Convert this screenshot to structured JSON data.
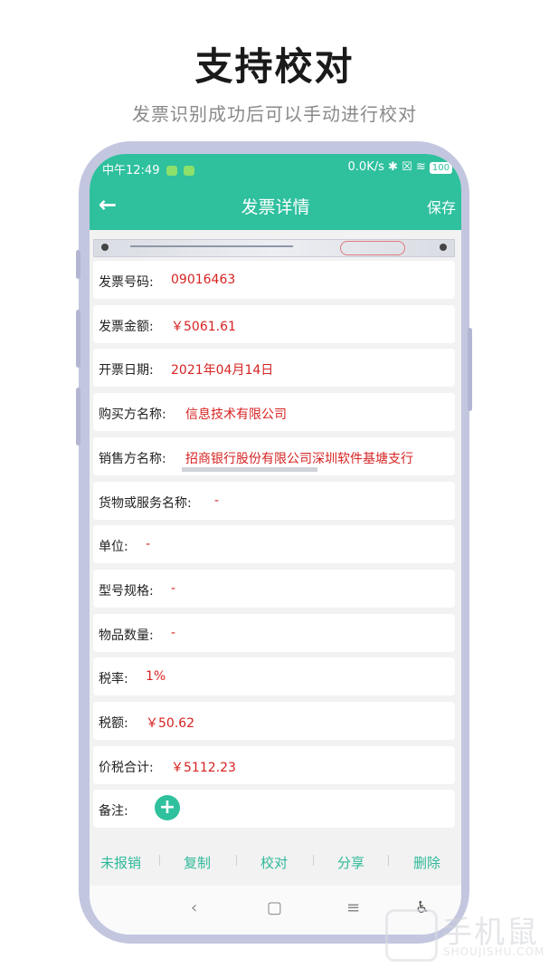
{
  "headline": "支持校对",
  "subheadline": "发票识别成功后可以手动进行校对",
  "status_bar": {
    "time": "中午12:49",
    "network": "0.0K/s",
    "battery": "100"
  },
  "app_bar": {
    "back_icon": "arrow-left-icon",
    "title": "发票详情",
    "save_label": "保存"
  },
  "fields": [
    {
      "label": "发票号码:",
      "value": "09016463"
    },
    {
      "label": "发票金额:",
      "value": "￥5061.61"
    },
    {
      "label": "开票日期:",
      "value": "2021年04月14日"
    },
    {
      "label": "购买方名称:",
      "value": "信息技术有限公司"
    },
    {
      "label": "销售方名称:",
      "value": "招商银行股份有限公司深圳软件基塘支行"
    },
    {
      "label": "货物或服务名称:",
      "value": "-"
    },
    {
      "label": "单位:",
      "value": "-"
    },
    {
      "label": "型号规格:",
      "value": "-"
    },
    {
      "label": "物品数量:",
      "value": "-"
    },
    {
      "label": "税率:",
      "value": "1%"
    },
    {
      "label": "税额:",
      "value": "￥50.62"
    },
    {
      "label": "价税合计:",
      "value": "￥5112.23"
    },
    {
      "label": "备注:",
      "value": ""
    }
  ],
  "actions": [
    "未报销",
    "复制",
    "校对",
    "分享",
    "删除"
  ],
  "nav": {
    "back": "‹",
    "home": "▢",
    "menu": "≡",
    "accessibility": "accessibility-icon"
  },
  "watermark": {
    "cn": "手机鼠",
    "en": "SHOUJISHU.COM"
  },
  "colors": {
    "accent": "#2fc09e",
    "value_red": "#d72323"
  }
}
